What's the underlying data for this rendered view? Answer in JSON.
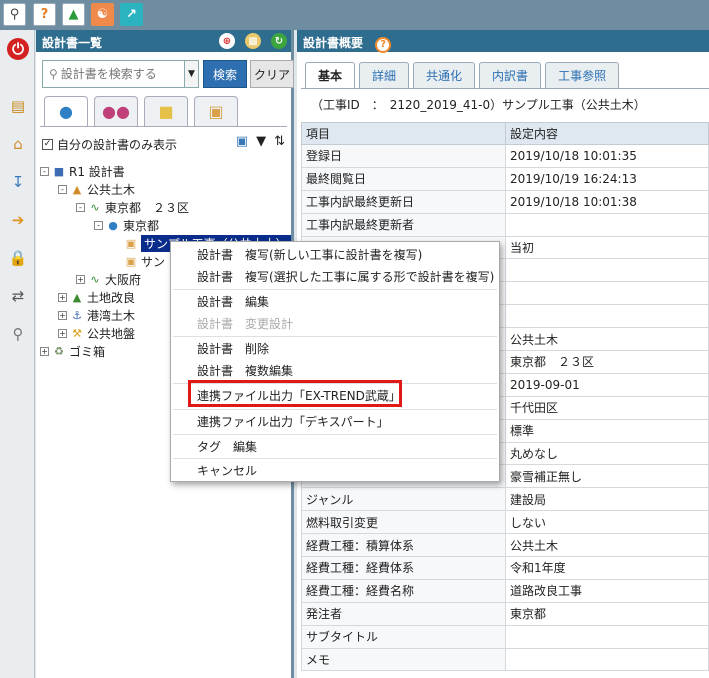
{
  "left_panel": {
    "title": "設計書一覧",
    "search": {
      "placeholder": "設計書を検索する",
      "value": ""
    },
    "search_button": "検索",
    "clear_button": "クリア",
    "own_only_label": "自分の設計書のみ表示",
    "own_only_checked": true,
    "tree": [
      {
        "label": "R1 設計書",
        "icon": "building-icon",
        "expand": "-"
      },
      {
        "label": "公共土木",
        "icon": "road-roller-icon",
        "expand": "-"
      },
      {
        "label": "東京都　２３区",
        "icon": "route-icon",
        "expand": "-"
      },
      {
        "label": "東京都",
        "icon": "person-icon",
        "expand": "-"
      },
      {
        "label": "サンプル工事（公共土木）",
        "icon": "document-icon",
        "selected": true
      },
      {
        "label": "サン",
        "icon": "document-icon"
      },
      {
        "label": "大阪府",
        "icon": "route-icon",
        "expand": "+"
      },
      {
        "label": "土地改良",
        "icon": "field-icon",
        "expand": "+"
      },
      {
        "label": "港湾土木",
        "icon": "harbor-icon",
        "expand": "+"
      },
      {
        "label": "公共地盤",
        "icon": "excavator-icon",
        "expand": "+"
      },
      {
        "label": "ゴミ箱",
        "icon": "trash-icon",
        "expand": "+"
      }
    ]
  },
  "right_panel": {
    "title": "設計書概要",
    "tabs": [
      "基本",
      "詳細",
      "共通化",
      "内訳書",
      "工事参照"
    ],
    "active_tab": "基本",
    "subtitle": "（工事ID　：　2120_2019_41-0）サンプル工事（公共土木）",
    "table_headers": [
      "項目",
      "設定内容"
    ],
    "rows": [
      [
        "登録日",
        "2019/10/18 10:01:35"
      ],
      [
        "最終閲覧日",
        "2019/10/19 16:24:13"
      ],
      [
        "工事内訳最終更新日",
        "2019/10/18 10:01:38"
      ],
      [
        "工事内訳最終更新者",
        ""
      ],
      [
        "",
        "当初"
      ],
      [
        "",
        ""
      ],
      [
        "",
        ""
      ],
      [
        "",
        ""
      ],
      [
        "",
        "公共土木"
      ],
      [
        "",
        "東京都　２３区"
      ],
      [
        "",
        "2019-09-01"
      ],
      [
        "",
        "千代田区"
      ],
      [
        "",
        "標準"
      ],
      [
        "",
        "丸めなし"
      ],
      [
        "",
        "豪雪補正無し"
      ],
      [
        "ジャンル",
        "建設局"
      ],
      [
        "燃料取引変更",
        "しない"
      ],
      [
        "経費工種：積算体系",
        "公共土木"
      ],
      [
        "経費工種：経費体系",
        "令和1年度"
      ],
      [
        "経費工種：経費名称",
        "道路改良工事"
      ],
      [
        "発注者",
        "東京都"
      ],
      [
        "サブタイトル",
        ""
      ],
      [
        "メモ",
        ""
      ]
    ]
  },
  "context_menu": {
    "items": [
      {
        "label": "設計書　複写(新しい工事に設計書を複写)",
        "enabled": true
      },
      {
        "label": "設計書　複写(選択した工事に属する形で設計書を複写)",
        "enabled": true
      },
      {
        "label": "設計書　編集",
        "enabled": true
      },
      {
        "label": "設計書　変更設計",
        "enabled": false
      },
      {
        "label": "設計書　削除",
        "enabled": true
      },
      {
        "label": "設計書　複数編集",
        "enabled": true
      },
      {
        "label": "連携ファイル出力「EX-TREND武蔵」",
        "enabled": true,
        "highlighted": true
      },
      {
        "label": "連携ファイル出力「デキスパート」",
        "enabled": true
      },
      {
        "label": "タグ　編集",
        "enabled": true
      },
      {
        "label": "キャンセル",
        "enabled": true
      }
    ]
  },
  "colors": {
    "header_blue": "#2f6d8f",
    "selected_navy": "#0a2d8c",
    "highlight_red": "#e01818",
    "search_button": "#2d6fb0"
  }
}
